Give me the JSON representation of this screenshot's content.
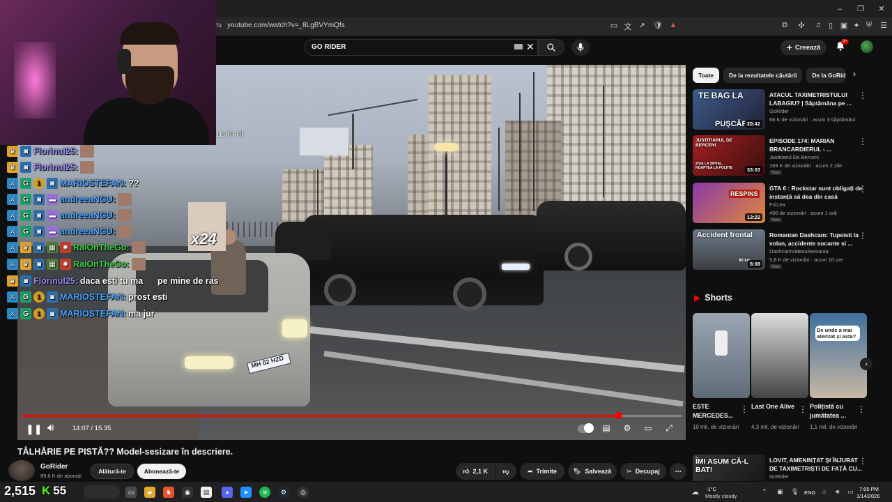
{
  "browser": {
    "url": "youtube.com/watch?v=_8LgBVYmQfs",
    "window_controls": [
      "–",
      "❐",
      "✕"
    ]
  },
  "header": {
    "search_value": "GO RIDER",
    "create_label": "Creează",
    "notif_count": "9+"
  },
  "overlay": {
    "partial_caption": "us la el",
    "multiplier": "x24"
  },
  "chat": [
    {
      "user": "Florinul25:",
      "color": "#9a8bf0",
      "msg": ""
    },
    {
      "user": "Florinul25:",
      "color": "#9a8bf0",
      "msg": ""
    },
    {
      "user": "MARIOSTEFAN:",
      "color": "#4aa3ff",
      "msg": "??"
    },
    {
      "user": "andreeaNGU:",
      "color": "#4aa3ff",
      "msg": ""
    },
    {
      "user": "andreeaNGU:",
      "color": "#4aa3ff",
      "msg": ""
    },
    {
      "user": "andreeaNGU:",
      "color": "#4aa3ff",
      "msg": ""
    },
    {
      "user": "RaiOnTheGo:",
      "color": "#3fd04a",
      "msg": ""
    },
    {
      "user": "RaiOnTheGo:",
      "color": "#3fd04a",
      "msg": ""
    },
    {
      "user": "Florinul25:",
      "color": "#9a8bf0",
      "msg": "daca esti tu ma      pe mine de ras"
    },
    {
      "user": "MARIOSTEFAN:",
      "color": "#4aa3ff",
      "msg": "prost esti"
    },
    {
      "user": "MARIOSTEFAN:",
      "color": "#4aa3ff",
      "msg": "ma jur"
    }
  ],
  "player": {
    "time": "14:07 / 15:35",
    "progress": 0.905
  },
  "video": {
    "title": "TÂLHĂRIE PE PISTĂ?? Model-sesizare în descriere.",
    "channel": "GoRider",
    "subs": "89,6 K de abonați",
    "join": "Alătură-te",
    "subscribe": "Abonează-te",
    "likes": "2,1 K",
    "share": "Trimite",
    "save": "Salvează",
    "clip": "Decupaj"
  },
  "filters": [
    "Toate",
    "De la rezultatele căutării",
    "De la GoRider"
  ],
  "recommendations": [
    {
      "title": "ATACUL TAXIMETRISTULUI LABAGIU? | Săptămâna pe ...",
      "channel": "GoRider",
      "views": "66 K de vizionări · acum 3 săptămâni",
      "duration": "20:42",
      "thumb_text": "TE BAG LA",
      "thumb_text2": "PUȘCĂRIE",
      "new": ""
    },
    {
      "title": "EPISODE 174: MARIAN BRANCARDIERUL - ...",
      "channel": "Justitiarul De Berceni",
      "views": "169 K de vizionări · acum 2 zile",
      "duration": "33:03",
      "thumb_text": "JUSTIȚIARUL DE BERCENI",
      "thumb_text2": "ZIUA LA SPITAL, NOAPTEA LA POLIȚIE",
      "new": "Nou"
    },
    {
      "title": "GTA 6 : Rockstar sunt obligați de instanță să dea din casă",
      "channel": "Fritzea",
      "views": "490 de vizionări · acum 1 oră",
      "duration": "13:22",
      "thumb_text": "RESPINS",
      "thumb_text2": "",
      "new": "Nou"
    },
    {
      "title": "Romanian Dashcam: Tupeisti la volan, accidente socante si ...",
      "channel": "DashcamVideosRomania",
      "views": "5,8 K de vizionări · acum 10 ore",
      "duration": "8:08",
      "thumb_text": "Accident frontal",
      "thumb_text2": "90 km",
      "new": "Nou"
    }
  ],
  "shorts": {
    "heading": "Shorts",
    "items": [
      {
        "title": "ESTE MERCEDES...",
        "views": "10 mil. de vizionări"
      },
      {
        "title": "Last One Alive",
        "views": "4,3 mil. de vizionări"
      },
      {
        "title": "Polițistă cu jumătatea ...",
        "views": "1,1 mil. de vizionări",
        "overlay": "De unde a mai aterizat și asta?"
      }
    ]
  },
  "bottom_rec": {
    "title": "LOVIT, AMENINȚAT ȘI ÎNJURAT DE TAXIMETRIȘTI DE FAȚĂ CU...",
    "channel": "GoRider",
    "thumb_text": "ÎMI ASUM CĂ-L BAT!"
  },
  "taskbar": {
    "counter": "2,515",
    "k_counter": "55",
    "temp": "-1°C",
    "weather": "Mostly cloudy",
    "lang": "ENG",
    "time": "7:05 PM",
    "date": "1/14/2026"
  }
}
